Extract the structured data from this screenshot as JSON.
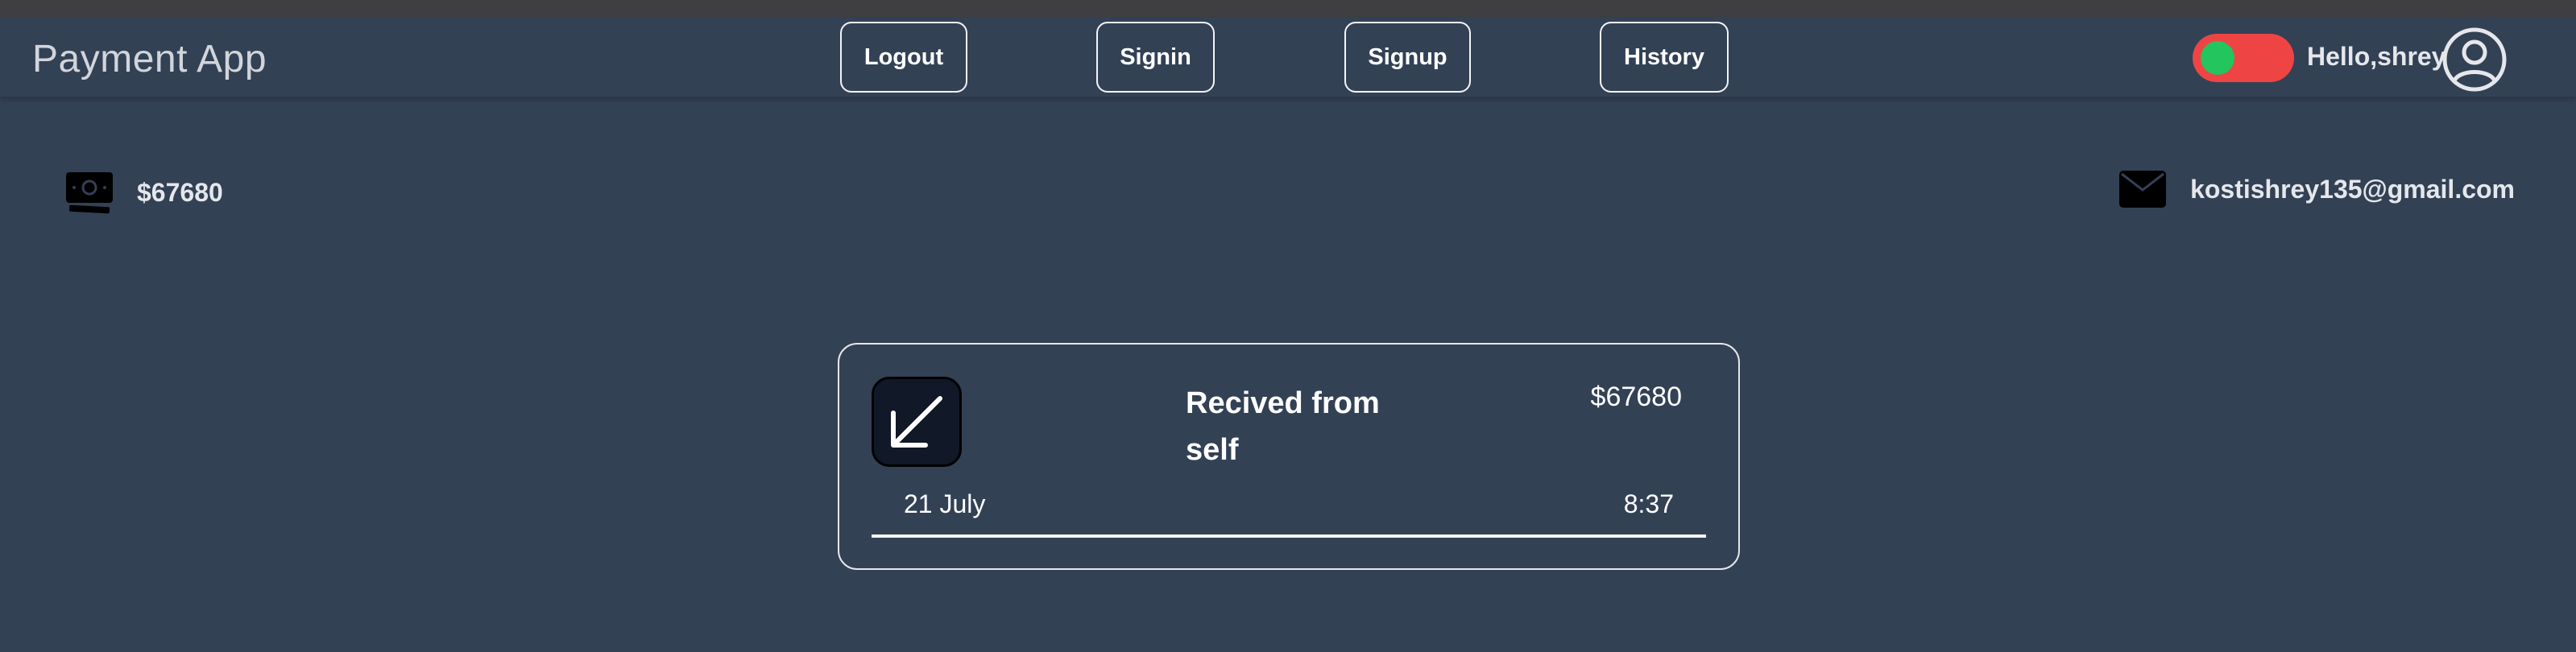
{
  "app": {
    "title": "Payment App"
  },
  "nav": {
    "buttons": [
      {
        "label": "Logout"
      },
      {
        "label": "Signin"
      },
      {
        "label": "Signup"
      },
      {
        "label": "History"
      }
    ]
  },
  "user": {
    "greeting": "Hello,shrey",
    "theme_toggle": {
      "state": "on"
    }
  },
  "account": {
    "balance": "$67680",
    "email": "kostishrey135@gmail.com"
  },
  "transactions": [
    {
      "title": "Recived from self",
      "amount": "$67680",
      "date": "21 July",
      "time": "8:37",
      "direction_icon": "arrow-down-left-icon"
    }
  ],
  "colors": {
    "background": "#334155",
    "toggle_track": "#ef4444",
    "toggle_knob": "#22c55e",
    "text": "#e5e7eb"
  }
}
